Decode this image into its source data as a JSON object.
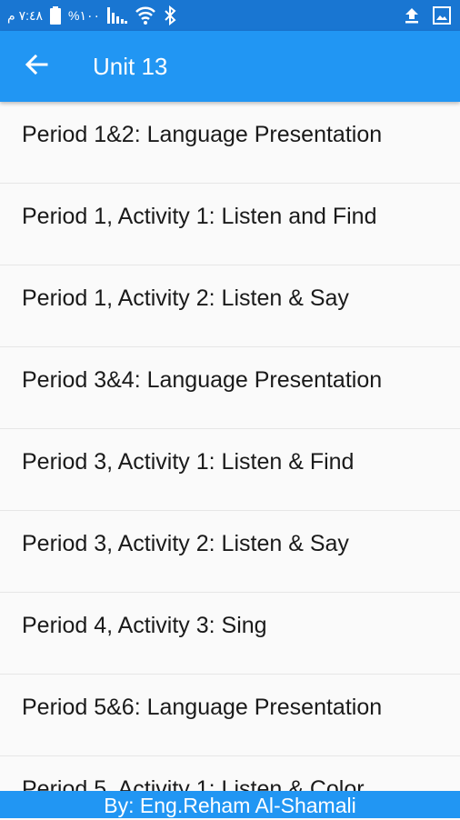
{
  "status_bar": {
    "time": "٧:٤٨ م",
    "battery": "%١٠٠",
    "icons": [
      "battery-icon",
      "signal-icon",
      "wifi-icon",
      "bluetooth-icon",
      "upload-icon",
      "image-icon"
    ]
  },
  "app_bar": {
    "title": "Unit 13",
    "back_icon": "arrow-left-icon"
  },
  "list": {
    "items": [
      {
        "label": "Period 1&2: Language Presentation"
      },
      {
        "label": "Period 1, Activity 1: Listen and Find"
      },
      {
        "label": "Period 1, Activity 2: Listen & Say"
      },
      {
        "label": "Period 3&4: Language Presentation"
      },
      {
        "label": "Period 3, Activity 1: Listen & Find"
      },
      {
        "label": "Period 3, Activity 2: Listen & Say"
      },
      {
        "label": "Period 4, Activity 3: Sing"
      },
      {
        "label": "Period 5&6: Language Presentation"
      },
      {
        "label": "Period 5, Activity 1: Listen & Color"
      }
    ]
  },
  "footer": {
    "text": "By: Eng.Reham Al-Shamali"
  },
  "colors": {
    "status_bar": "#1976d2",
    "app_bar": "#2196f3",
    "footer": "#2196f3",
    "background": "#fafafa",
    "divider": "#e6e6e6"
  }
}
